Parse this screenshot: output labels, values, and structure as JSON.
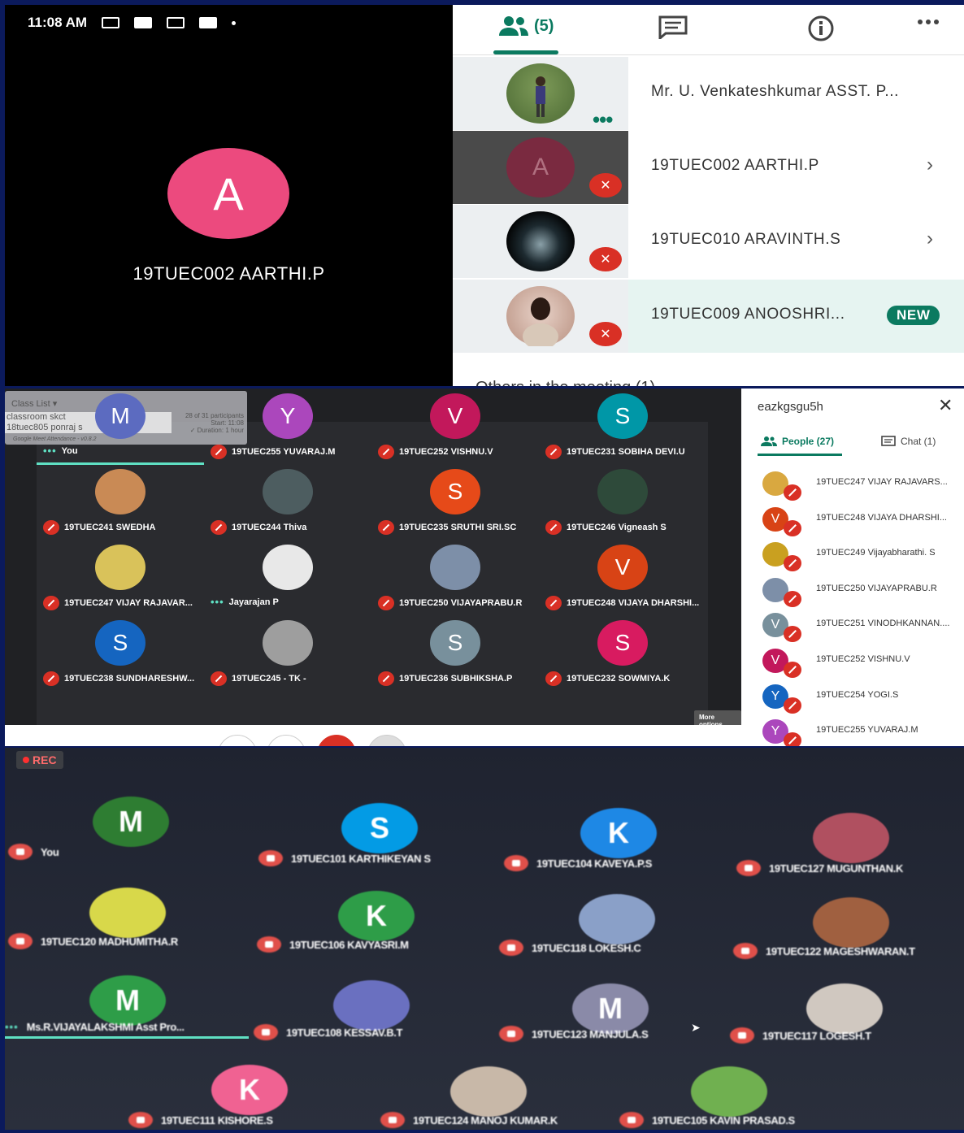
{
  "mobile": {
    "status_time": "11:08 AM",
    "speaker_initial": "A",
    "speaker_name": "19TUEC002 AARTHI.P",
    "people_count": "(5)",
    "participants": [
      {
        "name": "Mr. U. Venkateshkumar ASST. P...",
        "avatar": "photo-field"
      },
      {
        "name": "19TUEC002 AARTHI.P",
        "avatar": "A"
      },
      {
        "name": "19TUEC010 ARAVINTH.S",
        "avatar": "photo-dark"
      },
      {
        "name": "19TUEC009 ANOOSHRI...",
        "avatar": "photo-selfie",
        "badge": "NEW"
      }
    ],
    "others_heading": "Others in the meeting (1)"
  },
  "desktop": {
    "extension": {
      "title": "Class List",
      "list_line1": "classroom skct",
      "list_line2": "18tuec805 ponraj s",
      "stats_line1": "28 of 31 participants",
      "stats_line2": "Start: 11:08",
      "stats_line3": "✓ Duration: 1 hour",
      "footer": "Google Meet Attendance - v0.8.2"
    },
    "tiles": [
      {
        "initial": "M",
        "label": "You",
        "color": "#5c6bc0",
        "state": "speaking"
      },
      {
        "initial": "Y",
        "label": "19TUEC255 YUVARAJ.M",
        "color": "#ab47bc",
        "state": "muted"
      },
      {
        "initial": "V",
        "label": "19TUEC252 VISHNU.V",
        "color": "#c2185b",
        "state": "muted"
      },
      {
        "initial": "S",
        "label": "19TUEC231 SOBIHA DEVI.U",
        "color": "#0097a7",
        "state": "muted"
      },
      {
        "initial": "",
        "label": "19TUEC241 SWEDHA",
        "color": "#c98a55",
        "state": "muted"
      },
      {
        "initial": "",
        "label": "19TUEC244 Thiva",
        "color": "#4d5d60",
        "state": "muted"
      },
      {
        "initial": "S",
        "label": "19TUEC235 SRUTHI SRI.SC",
        "color": "#e64a19",
        "state": "muted"
      },
      {
        "initial": "",
        "label": "19TUEC246 Vigneash S",
        "color": "#2e4a3a",
        "state": "muted"
      },
      {
        "initial": "",
        "label": "19TUEC247 VIJAY RAJAVAR...",
        "color": "#d9c25a",
        "state": "muted"
      },
      {
        "initial": "",
        "label": "Jayarajan P",
        "color": "#e8e8e8",
        "state": "speaking"
      },
      {
        "initial": "",
        "label": "19TUEC250 VIJAYAPRABU.R",
        "color": "#7d8fa8",
        "state": "muted"
      },
      {
        "initial": "V",
        "label": "19TUEC248 VIJAYA DHARSHI...",
        "color": "#d84315",
        "state": "muted"
      },
      {
        "initial": "S",
        "label": "19TUEC238 SUNDHARESHW...",
        "color": "#1565c0",
        "state": "muted"
      },
      {
        "initial": "",
        "label": "19TUEC245 - TK -",
        "color": "#9e9e9e",
        "state": "muted"
      },
      {
        "initial": "S",
        "label": "19TUEC236 SUBHIKSHA.P",
        "color": "#78909c",
        "state": "muted"
      },
      {
        "initial": "S",
        "label": "19TUEC232 SOWMIYA.K",
        "color": "#d81b60",
        "state": "muted"
      }
    ],
    "more_options": "More options"
  },
  "sidepanel": {
    "meeting_code": "eazkgsgu5h",
    "people_tab": "People (27)",
    "chat_tab": "Chat (1)",
    "people": [
      {
        "initial": "",
        "name": "19TUEC247 VIJAY RAJAVARS...",
        "color": "#d9a840"
      },
      {
        "initial": "V",
        "name": "19TUEC248 VIJAYA DHARSHI...",
        "color": "#d84315"
      },
      {
        "initial": "",
        "name": "19TUEC249 Vijayabharathi. S",
        "color": "#c9a020"
      },
      {
        "initial": "",
        "name": "19TUEC250 VIJAYAPRABU.R",
        "color": "#7d8fa8"
      },
      {
        "initial": "V",
        "name": "19TUEC251 VINODHKANNAN....",
        "color": "#78909c"
      },
      {
        "initial": "V",
        "name": "19TUEC252 VISHNU.V",
        "color": "#c2185b"
      },
      {
        "initial": "Y",
        "name": "19TUEC254 YOGI.S",
        "color": "#1565c0"
      },
      {
        "initial": "Y",
        "name": "19TUEC255 YUVARAJ.M",
        "color": "#ab47bc"
      }
    ]
  },
  "blurry": {
    "rec": "REC",
    "tiles": [
      {
        "initial": "M",
        "label": "You",
        "color": "#2e7d32"
      },
      {
        "initial": "S",
        "label": "19TUEC101 KARTHIKEYAN S",
        "color": "#039be5"
      },
      {
        "initial": "K",
        "label": "19TUEC104 KAVEYA.P.S",
        "color": "#1e88e5"
      },
      {
        "initial": "",
        "label": "19TUEC127 MUGUNTHAN.K",
        "color": "#b05060"
      },
      {
        "initial": "",
        "label": "19TUEC120 MADHUMITHA.R",
        "color": "#d8d84a"
      },
      {
        "initial": "K",
        "label": "19TUEC106 KAVYASRI.M",
        "color": "#2e9d48"
      },
      {
        "initial": "",
        "label": "19TUEC118 LOKESH.C",
        "color": "#8aa0c8"
      },
      {
        "initial": "",
        "label": "19TUEC122 MAGESHWARAN.T",
        "color": "#a06040"
      },
      {
        "initial": "M",
        "label": "Ms.R.VIJAYALAKSHMI Asst Pro...",
        "color": "#2e9d48"
      },
      {
        "initial": "",
        "label": "19TUEC108 KESSAV.B.T",
        "color": "#6a70c0"
      },
      {
        "initial": "M",
        "label": "19TUEC123 MANJULA.S",
        "color": "#8a8aa8"
      },
      {
        "initial": "",
        "label": "19TUEC117 LOGESH.T",
        "color": "#d0c8c0"
      },
      {
        "initial": "K",
        "label": "19TUEC111 KISHORE.S",
        "color": "#f06292"
      },
      {
        "initial": "",
        "label": "19TUEC124 MANOJ KUMAR.K",
        "color": "#c8b8a8"
      },
      {
        "initial": "",
        "label": "19TUEC105 KAVIN PRASAD.S",
        "color": "#70b050"
      }
    ]
  }
}
